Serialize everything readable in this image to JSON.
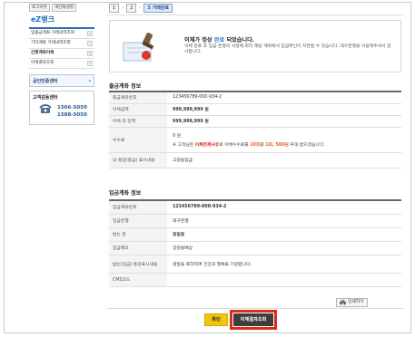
{
  "sidebar": {
    "top_buttons": [
      "로그아웃",
      "개인화설정"
    ],
    "brand": "eZ뱅크",
    "menu": [
      {
        "label": "입출금계좌 거래내역조회",
        "bold": false
      },
      {
        "label": "기타계좌 거래내역조회",
        "bold": false
      },
      {
        "label": "간편계좌이체",
        "bold": true
      },
      {
        "label": "이체결과조회",
        "bold": false
      }
    ],
    "cert_center": "공인인증센터",
    "customer_center": {
      "title": "고객감동센터",
      "phones": [
        "1566-5050",
        "1588-5050"
      ]
    }
  },
  "steps": {
    "items": [
      "1",
      "2",
      "3 거래완료"
    ],
    "separator": "›"
  },
  "banner": {
    "title_prefix": "이체가 정상 ",
    "title_highlight": "완료",
    "title_suffix": " 되었습니다.",
    "text": "이체 완료 후 입금 은행의 사정에 따라 해당 계좌에서 입금확인이 지연될 수 있습니다. 대구은행을 이용해주셔서 감사합니다."
  },
  "withdraw": {
    "title": "출금계좌 정보",
    "rows": {
      "account_label": "출금계좌번호",
      "account": "123456789-000-934-2",
      "amount_label": "이체금액",
      "amount": "999,999,999 원",
      "balance_label": "이체 후 잔액",
      "balance": "999,999,999 원",
      "fee_label": "수수료",
      "fee": "0 원",
      "fee_note_1": "※ 고객님은 ",
      "fee_note_red": "이체면제사유",
      "fee_note_2": "로 이체수수료를 ",
      "fee_note_count": "10회",
      "fee_note_3": "중 ",
      "fee_note_remaining": "1회, 500원",
      "fee_note_4": " 우대 받으셨습니다.",
      "memo_label": "내 통장(출금) 표시내용",
      "memo": "고길동입금"
    }
  },
  "deposit": {
    "title": "입금계좌 정보",
    "rows": {
      "account_label": "입금계좌번호",
      "account": "123456789-000-934-2",
      "bank_label": "입금은행",
      "bank": "대구은행",
      "receiver_label": "받는 분",
      "receiver": "장길동",
      "memo_label": "입금메모",
      "memo": "장길동배상",
      "recv_memo_label": "받는(입금) 통장표시내용",
      "recv_memo": "생일을 축하하며 건강과 행복을 기원합니다.",
      "cms_label": "CMS코드",
      "cms": ""
    }
  },
  "actions": {
    "print": "인쇄하기",
    "ok": "확인",
    "result": "이체결과조회"
  },
  "colors": {
    "accent_blue": "#2a7fd4",
    "highlight_red": "#e02a14",
    "ok_yellow": "#f1c40f"
  }
}
